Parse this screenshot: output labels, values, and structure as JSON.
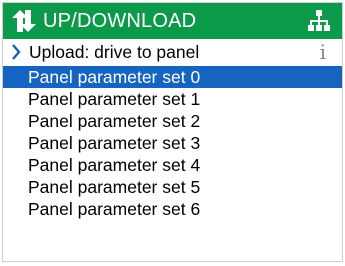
{
  "header": {
    "title": "UP/DOWNLOAD",
    "icon": "up-down-arrows-icon",
    "right_icon": "network-tree-icon",
    "color": "#0b9a4a"
  },
  "subheader": {
    "label": "Upload: drive to panel",
    "left_icon": "chevron-right-icon",
    "right_icon": "info-icon",
    "info_glyph": "i"
  },
  "list": {
    "selected_index": 0,
    "selected_color": "#1565c0",
    "items": [
      {
        "label": "Panel parameter set 0"
      },
      {
        "label": "Panel parameter set 1"
      },
      {
        "label": "Panel parameter set 2"
      },
      {
        "label": "Panel parameter set 3"
      },
      {
        "label": "Panel parameter set 4"
      },
      {
        "label": "Panel parameter set 5"
      },
      {
        "label": "Panel parameter set 6"
      }
    ]
  }
}
